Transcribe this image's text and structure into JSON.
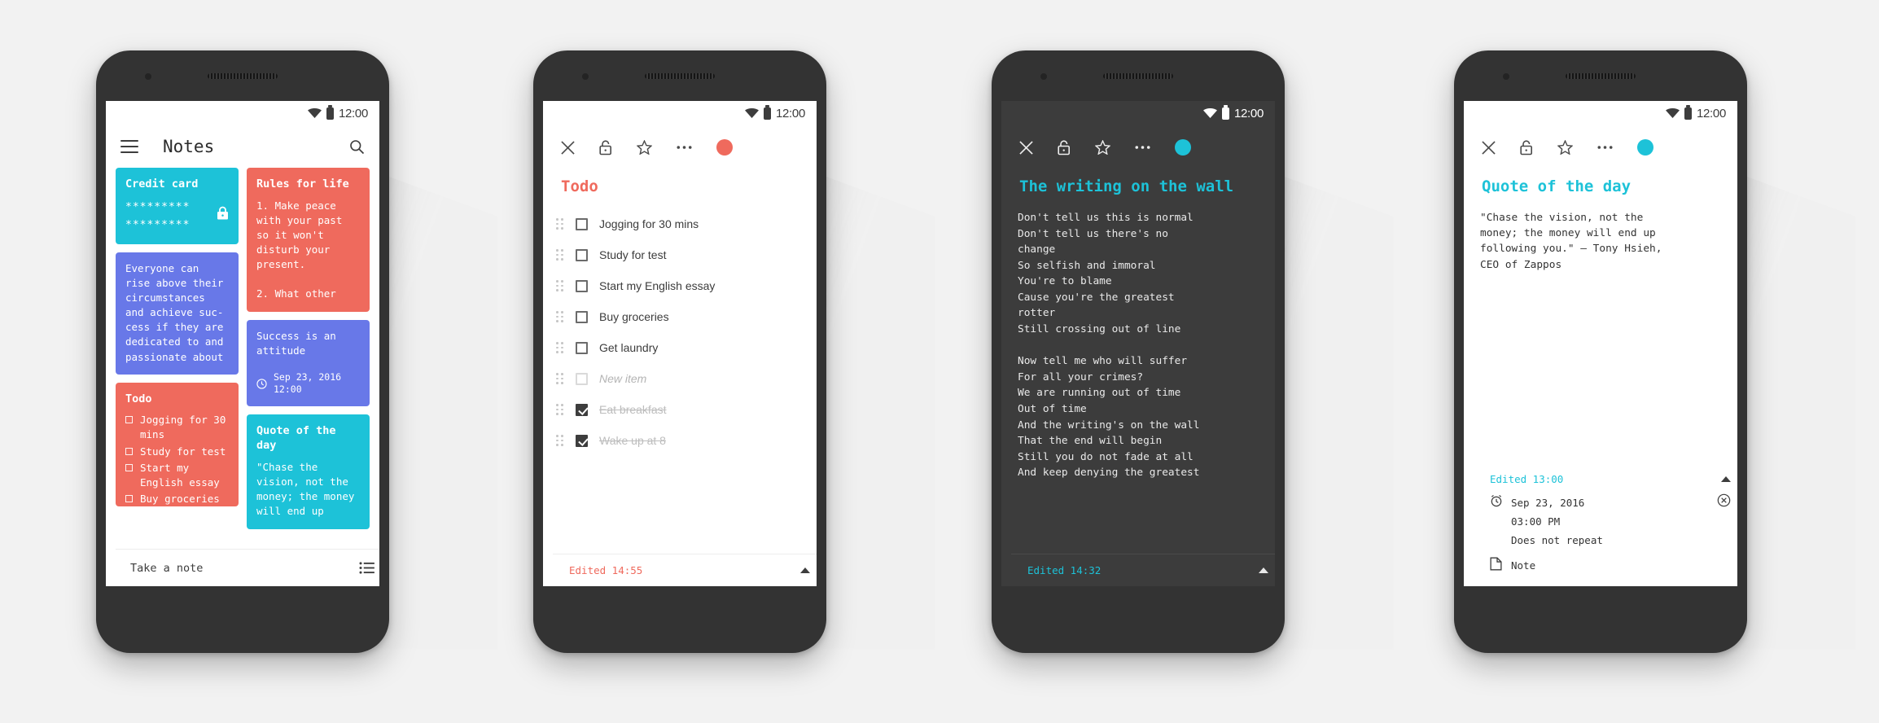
{
  "colors": {
    "red": "#ef6a5d",
    "teal": "#1dc2d8",
    "blue": "#6878e8",
    "dark": "#3c3c3c",
    "white": "#ffffff",
    "text_dark": "#3d3d3d",
    "muted": "#b4b4b4"
  },
  "status_bar": {
    "time": "12:00",
    "wifi_icon": "wifi-icon",
    "battery_icon": "battery-icon"
  },
  "phone1": {
    "appbar": {
      "menu_icon": "hamburger-menu-icon",
      "title": "Notes",
      "search_icon": "search-icon"
    },
    "notes": [
      {
        "id": "credit-card",
        "color": "#1dc2d8",
        "title": "Credit\ncard",
        "lines": [
          "*********",
          "*********"
        ],
        "locked": true,
        "lock_icon": "lock-icon"
      },
      {
        "id": "rules-for-life",
        "color": "#ef6a5d",
        "title": "Rules for life",
        "body": "1. Make peace\nwith your past\nso it won't\ndisturb your\npresent.\n\n2. What other"
      },
      {
        "id": "everyone-can-rise",
        "color": "#6878e8",
        "body": "Everyone can\nrise above their\ncircumstances\nand achieve suc-\ncess if they are\ndedicated to and\npassionate about"
      },
      {
        "id": "success-attitude",
        "color": "#6878e8",
        "body": "Success is an\nattitude",
        "reminder_icon": "clock-icon",
        "reminder_date": "Sep 23, 2016",
        "reminder_time": "12:00"
      },
      {
        "id": "todo",
        "color": "#ef6a5d",
        "title": "Todo",
        "items": [
          "Jogging for 30 mins",
          "Study for test",
          "Start my English essay",
          "Buy groceries"
        ]
      },
      {
        "id": "quote-of-the-day",
        "color": "#1dc2d8",
        "title": "Quote of the\nday",
        "body": "\"Chase the\nvision, not the\nmoney; the money\nwill end up"
      }
    ],
    "bottom_bar": {
      "placeholder": "Take a note",
      "list_icon": "list-view-icon"
    }
  },
  "phone2": {
    "toolbar": {
      "close_icon": "close-icon",
      "lock_icon": "unlock-icon",
      "star_icon": "star-outline-icon",
      "more_icon": "more-options-icon",
      "color_dot": "#ef6a5d"
    },
    "title": "Todo",
    "title_color": "#ef6a5d",
    "items": [
      {
        "label": "Jogging for 30 mins",
        "checked": false,
        "ghost": false
      },
      {
        "label": "Study for test",
        "checked": false,
        "ghost": false
      },
      {
        "label": "Start my English essay",
        "checked": false,
        "ghost": false
      },
      {
        "label": "Buy groceries",
        "checked": false,
        "ghost": false
      },
      {
        "label": "Get laundry",
        "checked": false,
        "ghost": false
      },
      {
        "label": "New item",
        "checked": false,
        "ghost": true
      },
      {
        "label": "Eat breakfast",
        "checked": true,
        "ghost": false
      },
      {
        "label": "Wake up at 8",
        "checked": true,
        "ghost": false
      }
    ],
    "footer": {
      "edited": "Edited 14:55",
      "expand_icon": "chevron-up-icon"
    }
  },
  "phone3": {
    "toolbar": {
      "close_icon": "close-icon",
      "lock_icon": "unlock-icon",
      "star_icon": "star-outline-icon",
      "more_icon": "more-options-icon",
      "color_dot": "#1dc2d8"
    },
    "title": "The writing on the wall",
    "title_color": "#1dc2d8",
    "body": "Don't tell us this is normal\nDon't tell us there's no\nchange\nSo selfish and immoral\nYou're to blame\nCause you're the greatest\nrotter\nStill crossing out of line\n\nNow tell me who will suffer\nFor all your crimes?\nWe are running out of time\nOut of time\nAnd the writing's on the wall\nThat the end will begin\nStill you do not fade at all\nAnd keep denying the greatest",
    "footer": {
      "edited": "Edited 14:32",
      "expand_icon": "chevron-up-icon"
    }
  },
  "phone4": {
    "toolbar": {
      "close_icon": "close-icon",
      "lock_icon": "unlock-icon",
      "star_icon": "star-outline-icon",
      "more_icon": "more-options-icon",
      "color_dot": "#1dc2d8"
    },
    "title": "Quote of the day",
    "title_color": "#1dc2d8",
    "body": "\"Chase the vision, not the\nmoney; the money will end up\nfollowing you.\" — Tony Hsieh,\nCEO of Zappos",
    "footer": {
      "edited": "Edited 13:00",
      "expand_icon": "chevron-up-icon"
    },
    "reminder": {
      "alarm_icon": "alarm-clock-icon",
      "date": "Sep 23, 2016",
      "time": "03:00 PM",
      "repeat": "Does not repeat",
      "remove_icon": "remove-reminder-icon",
      "type_icon": "note-file-icon",
      "type_label": "Note"
    }
  }
}
